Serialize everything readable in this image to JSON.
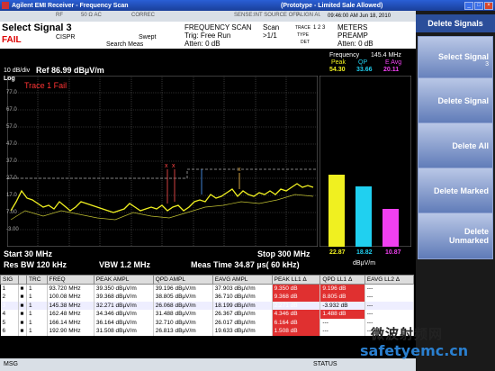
{
  "window": {
    "title": "Agilent EMI Receiver - Frequency Scan",
    "prototype": "(Prototype - Limited Sale Allowed)"
  },
  "statusbar": {
    "rf": "RF",
    "ohm": "50 Ω  AC",
    "correc": "CORREC",
    "sense": "SENSE:INT  SOURCE OFF",
    "align": "ALIGN AUTO",
    "datetime": "09:46:00 AM Jun 18, 2010"
  },
  "header": {
    "select_signal": "Select Signal  3",
    "fail": "FAIL",
    "cispr": "CISPR",
    "swept": "Swept",
    "search_meas": "Search Meas",
    "freq_scan": "FREQUENCY SCAN",
    "trig": "Trig: Free Run",
    "atten": "Atten: 0 dB",
    "scan": "Scan",
    "scan_count": ">1/1",
    "trace": "TRACE",
    "type": "TYPE",
    "det": "DET",
    "trace_vals": "1 2 3",
    "meters": "METERS",
    "preamp": "PREAMP",
    "meters_atten": "Atten: 0 dB"
  },
  "plot": {
    "dbdiv": "10 dB/div",
    "ref": "Ref 86.99 dBµV/m",
    "log": "Log",
    "trace_fail": "Trace 1 Fail",
    "y_ticks": [
      "77.0",
      "67.0",
      "57.0",
      "47.0",
      "37.0",
      "27.0",
      "17.0",
      "7.00",
      "-3.00"
    ],
    "start": "Start 30 MHz",
    "stop": "Stop 300 MHz",
    "res_bw": "Res BW 120 kHz",
    "vbw": "VBW 1.2 MHz",
    "meas_time": "Meas Time 34.87 µs( 60 kHz)"
  },
  "meters": {
    "frequency_label": "Frequency",
    "frequency": "145.4 MHz",
    "peak_label": "Peak",
    "qp_label": "QP",
    "eavg_label": "E Avg",
    "peak_val": "54.30",
    "qp_val": "33.66",
    "eavg_val": "20.11",
    "peak_bottom": "22.87",
    "qp_bottom": "18.82",
    "eavg_bottom": "10.87",
    "unit": "dBµV/m",
    "levels": [
      0.42,
      0.35,
      0.22
    ],
    "colors": [
      "#f0f020",
      "#20d0f0",
      "#f040f0"
    ]
  },
  "table": {
    "headers": [
      "SIG",
      "",
      "TRC",
      "FREQ",
      "PEAK AMPL",
      "QPD AMPL",
      "EAVG AMPL",
      "PEAK LL1 Δ",
      "QPD LL1 Δ",
      "EAVG LL2 Δ"
    ],
    "rows": [
      {
        "sig": "1",
        "trc": "1",
        "freq": "93.720 MHz",
        "peak": "39.350 dBµV/m",
        "qpd": "39.196 dBµV/m",
        "eavg": "37.903 dBµV/m",
        "pll": "9.350 dB",
        "qll": "9.196 dB",
        "ell": "---"
      },
      {
        "sig": "2",
        "trc": "1",
        "freq": "100.08 MHz",
        "peak": "39.368 dBµV/m",
        "qpd": "38.805 dBµV/m",
        "eavg": "36.710 dBµV/m",
        "pll": "9.368 dB",
        "qll": "8.805 dB",
        "ell": "---"
      },
      {
        "sig": "3",
        "trc": "1",
        "freq": "145.38 MHz",
        "peak": "32.271 dBµV/m",
        "qpd": "26.068 dBµV/m",
        "eavg": "18.199 dBµV/m",
        "pll": "2.271 dB",
        "qll": "-3.932 dB",
        "ell": "---"
      },
      {
        "sig": "4",
        "trc": "1",
        "freq": "162.48 MHz",
        "peak": "34.346 dBµV/m",
        "qpd": "31.488 dBµV/m",
        "eavg": "26.367 dBµV/m",
        "pll": "4.346 dB",
        "qll": "1.488 dB",
        "ell": "---"
      },
      {
        "sig": "5",
        "trc": "1",
        "freq": "166.14 MHz",
        "peak": "36.164 dBµV/m",
        "qpd": "32.710 dBµV/m",
        "eavg": "26.017 dBµV/m",
        "pll": "6.164 dB",
        "qll": "---",
        "ell": "---"
      },
      {
        "sig": "6",
        "trc": "1",
        "freq": "192.90 MHz",
        "peak": "31.508 dBµV/m",
        "qpd": "26.813 dBµV/m",
        "eavg": "19.633 dBµV/m",
        "pll": "1.508 dB",
        "qll": "---",
        "ell": "---"
      }
    ]
  },
  "msg": "MSG",
  "status": "STATUS",
  "softkeys": {
    "title": "Delete Signals",
    "select_signal": "Select Signal",
    "select_signal_val": "3",
    "delete_signal": "Delete Signal",
    "delete_all": "Delete All",
    "delete_marked": "Delete Marked",
    "delete": "Delete",
    "unmarked": "Unmarked"
  },
  "watermark": {
    "cn": "微波射频网",
    "url": "safetyemc.cn"
  }
}
